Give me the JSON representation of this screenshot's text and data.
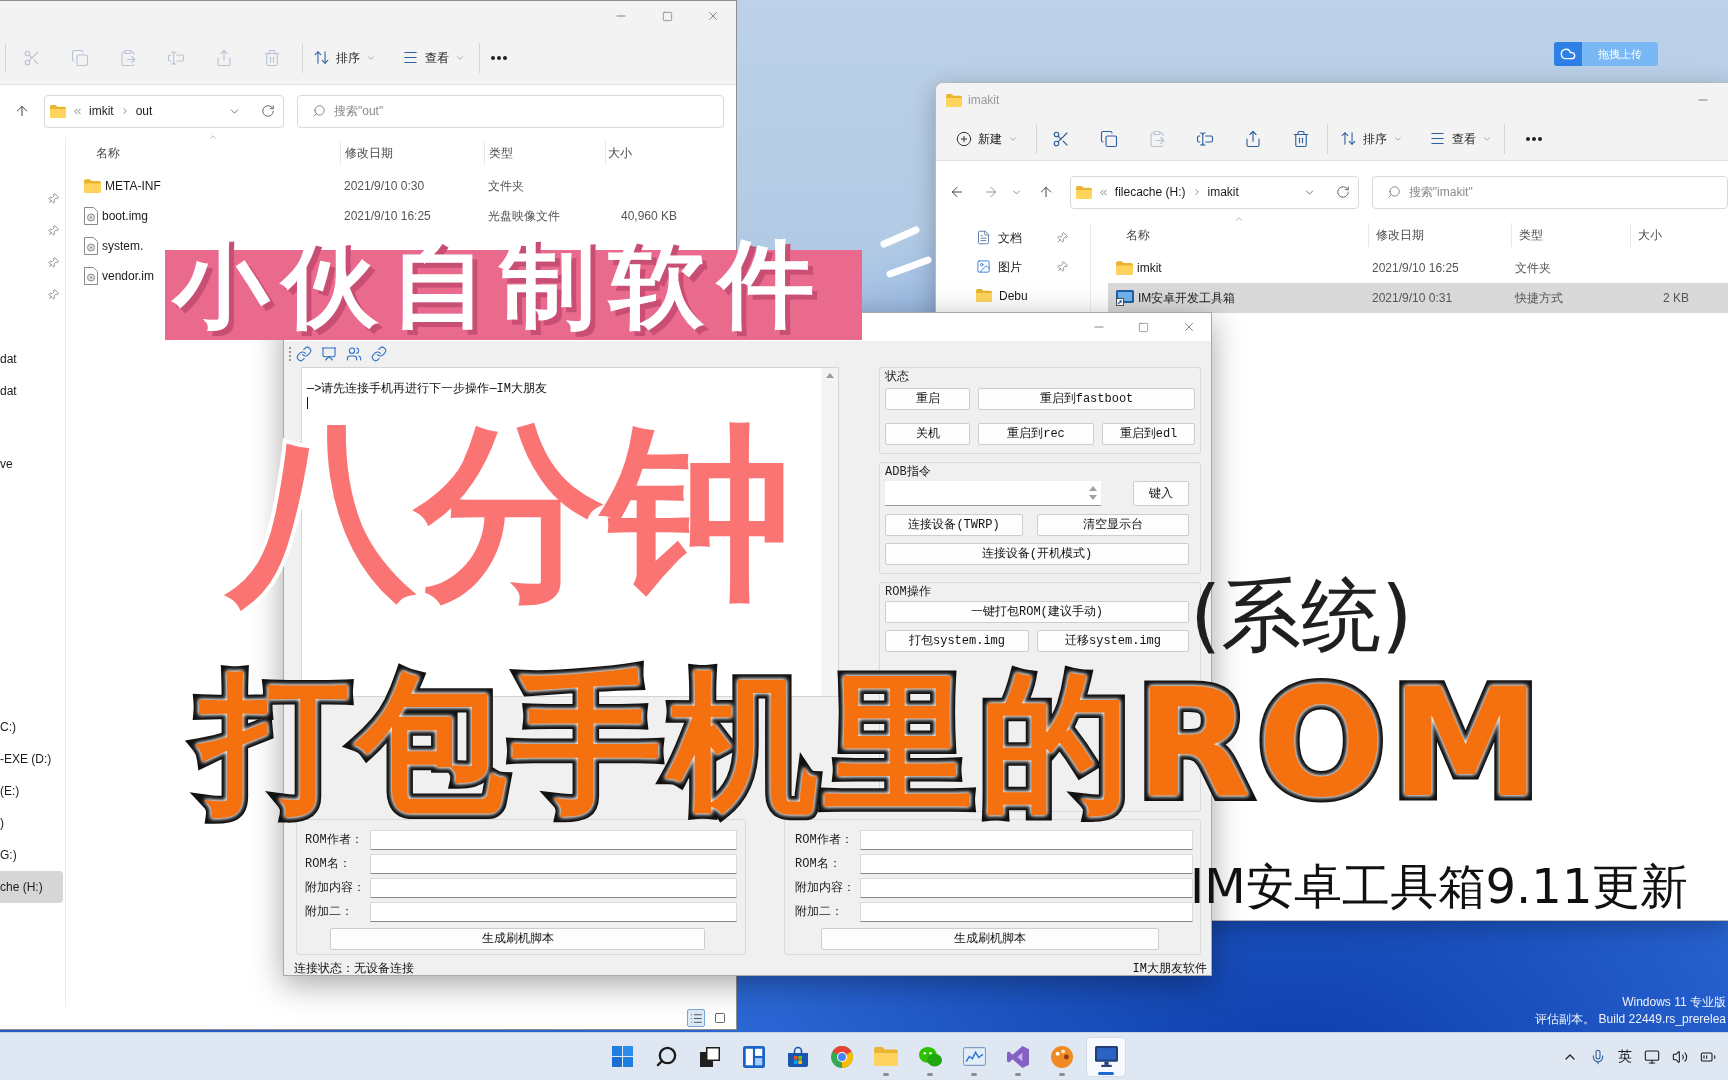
{
  "desktop": {
    "upload_button": {
      "label": "拖拽上传"
    },
    "edition_lines": [
      "Windows 11 专业版",
      "评估副本。 Build 22449.rs_prerelea"
    ]
  },
  "explorer_left": {
    "toolbar": {
      "actions": [
        {
          "kind": "cut",
          "disabled": true
        },
        {
          "kind": "copy",
          "disabled": true
        },
        {
          "kind": "paste",
          "disabled": true
        },
        {
          "kind": "rename",
          "disabled": true
        },
        {
          "kind": "share",
          "disabled": true
        },
        {
          "kind": "delete",
          "disabled": true
        }
      ],
      "sort_label": "排序",
      "view_label": "查看"
    },
    "address": {
      "crumbs": [
        "imkit",
        "out"
      ]
    },
    "search": {
      "placeholder": "搜索\"out\""
    },
    "sidebar": {
      "sections": [
        {
          "items": [
            {
              "pinned": true,
              "selected": false
            },
            {
              "pinned": true,
              "selected": false
            },
            {
              "pinned": true,
              "selected": false
            },
            {
              "pinned": true,
              "selected": false
            }
          ]
        },
        {
          "items": [
            {
              "label": "dat",
              "pinned": false,
              "selected": false
            },
            {
              "label": "dat",
              "pinned": false,
              "selected": false
            }
          ]
        },
        {
          "items": [
            {
              "label": "ve",
              "pinned": false,
              "selected": false
            }
          ]
        },
        {
          "items": [
            {
              "label": "C:)",
              "pinned": false,
              "selected": false
            },
            {
              "label": "-EXE (D:)",
              "pinned": false,
              "selected": false
            },
            {
              "label": "(E:)",
              "pinned": false,
              "selected": false
            },
            {
              "label": ")",
              "pinned": false,
              "selected": false
            },
            {
              "label": "G:)",
              "pinned": false,
              "selected": false
            },
            {
              "label": "che (H:)",
              "pinned": false,
              "selected": true
            }
          ]
        }
      ]
    },
    "columns": [
      "名称",
      "修改日期",
      "类型",
      "大小"
    ],
    "files": [
      {
        "kind": "folder",
        "name": "META-INF",
        "modified": "2021/9/10 0:30",
        "type": "文件夹",
        "selected": false
      },
      {
        "kind": "disc-image",
        "name": "boot.img",
        "modified": "2021/9/10 16:25",
        "type": "光盘映像文件",
        "size": "40,960 KB",
        "selected": false
      },
      {
        "kind": "disc-image",
        "name": "system.",
        "selected": false
      },
      {
        "kind": "disc-image",
        "name": "vendor.im",
        "selected": false
      }
    ],
    "view_modes": [
      {
        "kind": "details",
        "selected": true
      },
      {
        "kind": "tiles",
        "selected": false
      }
    ]
  },
  "explorer_right": {
    "title": "imakit",
    "toolbar": {
      "new_label": "新建",
      "actions": [
        {
          "kind": "cut",
          "disabled": false
        },
        {
          "kind": "copy",
          "disabled": false
        },
        {
          "kind": "paste",
          "disabled": true
        },
        {
          "kind": "rename",
          "disabled": false
        },
        {
          "kind": "share",
          "disabled": false
        },
        {
          "kind": "delete",
          "disabled": false
        }
      ],
      "sort_label": "排序",
      "view_label": "查看"
    },
    "address": {
      "crumbs": [
        "filecache (H:)",
        "imakit"
      ]
    },
    "search": {
      "placeholder": "搜索\"imakit\""
    },
    "sidebar": {
      "items": [
        {
          "kind": "documents",
          "label": "文档",
          "pinned": true,
          "selected": false
        },
        {
          "kind": "pictures",
          "label": "图片",
          "pinned": true,
          "selected": false
        },
        {
          "kind": "folder",
          "label": "Debu",
          "pinned": false,
          "selected": false
        }
      ]
    },
    "columns": [
      "名称",
      "修改日期",
      "类型",
      "大小"
    ],
    "files": [
      {
        "kind": "folder",
        "name": "imkit",
        "modified": "2021/9/10 16:25",
        "type": "文件夹",
        "selected": false
      },
      {
        "kind": "shortcut",
        "name": "IM安卓开发工具箱",
        "modified": "2021/9/10 0:31",
        "type": "快捷方式",
        "size": "2 KB",
        "selected": true
      }
    ]
  },
  "tool_window": {
    "console_lines": [
      "—>请先连接手机再进行下一步操作—IM大朋友"
    ],
    "status_group": {
      "title": "状态",
      "rows": [
        [
          "重启",
          "重启到fastboot"
        ],
        [
          "关机",
          "重启到rec",
          "重启到edl"
        ]
      ]
    },
    "adb_group": {
      "title": "ADB指令",
      "enter_button": "键入",
      "rows": [
        [
          "连接设备(TWRP)",
          "清空显示台"
        ],
        [
          "连接设备(开机模式)"
        ]
      ]
    },
    "rom_group": {
      "title": "ROM操作",
      "rows": [
        [
          "一键打包ROM(建议手动)"
        ],
        [
          "打包system.img",
          "迁移system.img"
        ]
      ]
    },
    "script_forms": [
      {
        "fields": [
          "ROM作者：",
          "ROM名：",
          "附加内容：",
          "附加二："
        ],
        "button": "生成刷机脚本"
      },
      {
        "fields": [
          "ROM作者：",
          "ROM名：",
          "附加内容：",
          "附加二："
        ],
        "button": "生成刷机脚本"
      }
    ],
    "status_bar": {
      "connection": "连接状态：无设备连接",
      "credit": "IM大朋友软件"
    }
  },
  "overlay": {
    "tagline": "小伙自制软件",
    "duration": "八分钟",
    "system_note": "(系统)",
    "headline": "打包手机里的ROM",
    "caption": "IM安卓工具箱9.11更新"
  },
  "taskbar": {
    "apps": [
      {
        "kind": "start",
        "running": false,
        "selected": false
      },
      {
        "kind": "search",
        "running": false,
        "selected": false
      },
      {
        "kind": "task-view",
        "running": false,
        "selected": false
      },
      {
        "kind": "widgets",
        "running": false,
        "selected": false
      },
      {
        "kind": "store",
        "running": false,
        "selected": false
      },
      {
        "kind": "browser",
        "running": false,
        "selected": false
      },
      {
        "kind": "files",
        "running": true,
        "selected": false
      },
      {
        "kind": "chat",
        "running": true,
        "selected": false
      },
      {
        "kind": "monitor",
        "running": true,
        "selected": false
      },
      {
        "kind": "ide",
        "running": true,
        "selected": false
      },
      {
        "kind": "paint",
        "running": true,
        "selected": false
      },
      {
        "kind": "remote",
        "running": true,
        "selected": true
      }
    ],
    "tray": {
      "language": "英"
    }
  }
}
